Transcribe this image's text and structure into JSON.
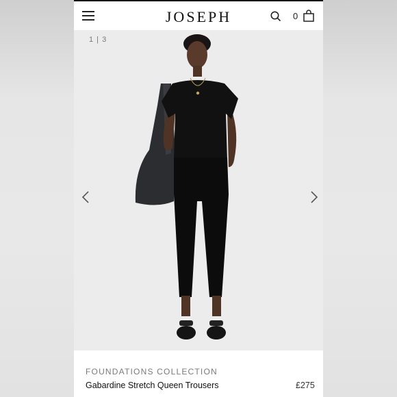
{
  "header": {
    "logo": "JOSEPH",
    "cart_count": "0"
  },
  "gallery": {
    "counter": "1 | 3"
  },
  "product": {
    "collection": "FOUNDATIONS COLLECTION",
    "name": "Gabardine Stretch Queen Trousers",
    "price": "£275"
  },
  "icons": {
    "menu": "hamburger-icon",
    "search": "search-icon",
    "bag": "shopping-bag-icon",
    "prev": "chevron-left-icon",
    "next": "chevron-right-icon"
  }
}
